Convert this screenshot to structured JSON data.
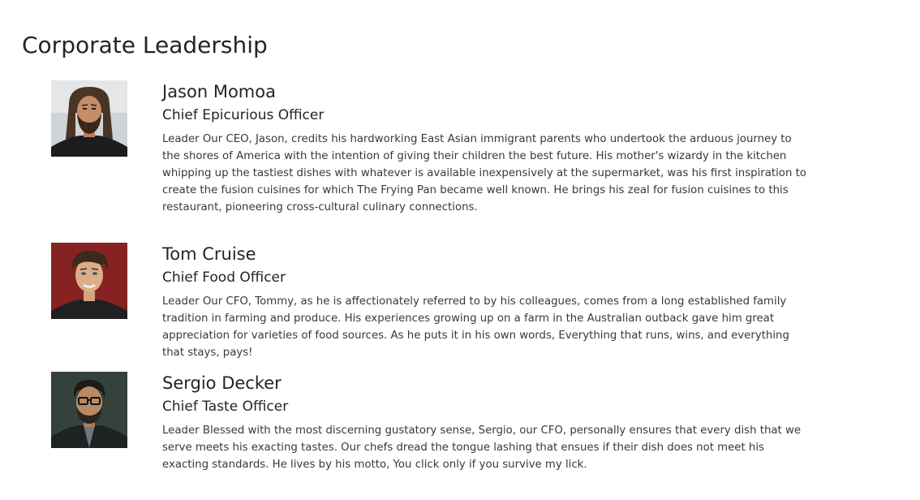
{
  "section": {
    "title": "Corporate Leadership"
  },
  "leaders": [
    {
      "name": "Jason Momoa",
      "title": "Chief Epicurious Officer",
      "description": "Leader Our CEO, Jason, credits his hardworking East Asian immigrant parents who undertook the arduous journey to the shores of America with the intention of giving their children the best future. His mother's wizardy in the kitchen whipping up the tastiest dishes with whatever is available inexpensively at the supermarket, was his first inspiration to create the fusion cuisines for which The Frying Pan became well known. He brings his zeal for fusion cuisines to this restaurant, pioneering cross-cultural culinary connections.",
      "photo_icon": "portrait-long-hair-beard"
    },
    {
      "name": "Tom Cruise",
      "title": "Chief Food Officer",
      "description": "Leader Our CFO, Tommy, as he is affectionately referred to by his colleagues, comes from a long established family tradition in farming and produce. His experiences growing up on a farm in the Australian outback gave him great appreciation for varieties of food sources. As he puts it in his own words, Everything that runs, wins, and everything that stays, pays!",
      "photo_icon": "portrait-short-hair"
    },
    {
      "name": "Sergio Decker",
      "title": "Chief Taste Officer",
      "description": "Leader Blessed with the most discerning gustatory sense, Sergio, our CFO, personally ensures that every dish that we serve meets his exacting tastes. Our chefs dread the tongue lashing that ensues if their dish does not meet his exacting standards. He lives by his motto, You click only if you survive my lick.",
      "photo_icon": "portrait-glasses-beard"
    }
  ]
}
